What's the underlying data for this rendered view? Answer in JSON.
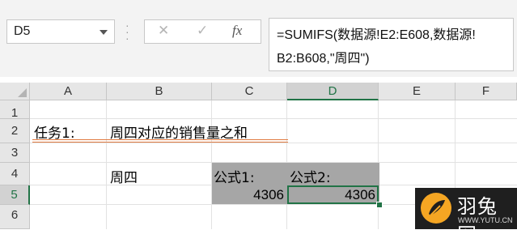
{
  "name_box": {
    "value": "D5"
  },
  "formula_bar": {
    "cancel_icon": "✕",
    "enter_icon": "✓",
    "fx_label": "fx",
    "formula_line1": "=SUMIFS(数据源!E2:E608,数据源!",
    "formula_line2": "B2:B608,\"周四\")"
  },
  "columns": [
    "A",
    "B",
    "C",
    "D",
    "E",
    "F"
  ],
  "rows": [
    "1",
    "2",
    "3",
    "4",
    "5",
    "6"
  ],
  "selected_column": "D",
  "selected_row": "5",
  "cells": {
    "A2": "任务1:",
    "B2": "周四对应的销售量之和",
    "B4": "周四",
    "C4": "公式1:",
    "D4": "公式2:",
    "C5": "4306",
    "D5": "4306"
  },
  "colors": {
    "accent": "#217346",
    "underline": "#e07a3f",
    "shade": "#a6a6a6"
  },
  "watermark": {
    "title": "羽兔网",
    "url": "WWW.YUTU.CN",
    "icon": "feather-logo-icon"
  }
}
